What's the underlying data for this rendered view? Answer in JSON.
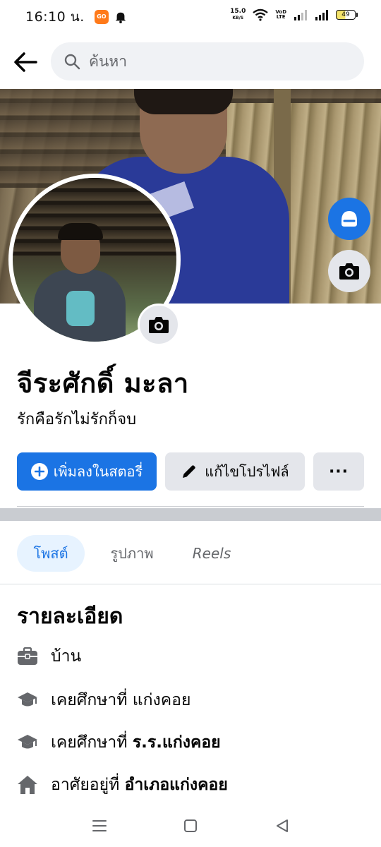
{
  "status_bar": {
    "time": "16:10 น.",
    "app_badge": "GO",
    "net_speed_value": "15.0",
    "net_speed_unit": "KB/S",
    "volte_top": "VoD",
    "volte_bottom": "LTE",
    "battery_level": "49"
  },
  "search": {
    "placeholder": "ค้นหา"
  },
  "profile": {
    "name": "จีระศักดิ์ มะลา",
    "bio": "รักคือรักไม่รักก็จบ"
  },
  "actions": {
    "add_story_label": "เพิ่มลงในสตอรี่",
    "edit_profile_label": "แก้ไขโปรไฟล์",
    "more_label": "···"
  },
  "tabs": [
    {
      "label": "โพสต์",
      "active": true
    },
    {
      "label": "รูปภาพ",
      "active": false
    },
    {
      "label": "Reels",
      "active": false
    }
  ],
  "details": {
    "title": "รายละเอียด",
    "items": [
      {
        "icon": "briefcase-icon",
        "text": "บ้าน",
        "strong": ""
      },
      {
        "icon": "graduation-cap-icon",
        "text": "เคยศึกษาที่ แก่งคอย",
        "strong": ""
      },
      {
        "icon": "graduation-cap-icon",
        "text": "เคยศึกษาที่ ",
        "strong": "ร.ร.แก่งคอย"
      },
      {
        "icon": "home-icon",
        "text": "อาศัยอยู่ที่ ",
        "strong": "อำเภอแก่งคอย"
      }
    ]
  },
  "colors": {
    "primary": "#1b74e4",
    "secondary_bg": "#e4e6eb",
    "search_bg": "#f0f2f5",
    "active_tab_bg": "#e7f3ff",
    "icon_gray": "#65676b"
  }
}
